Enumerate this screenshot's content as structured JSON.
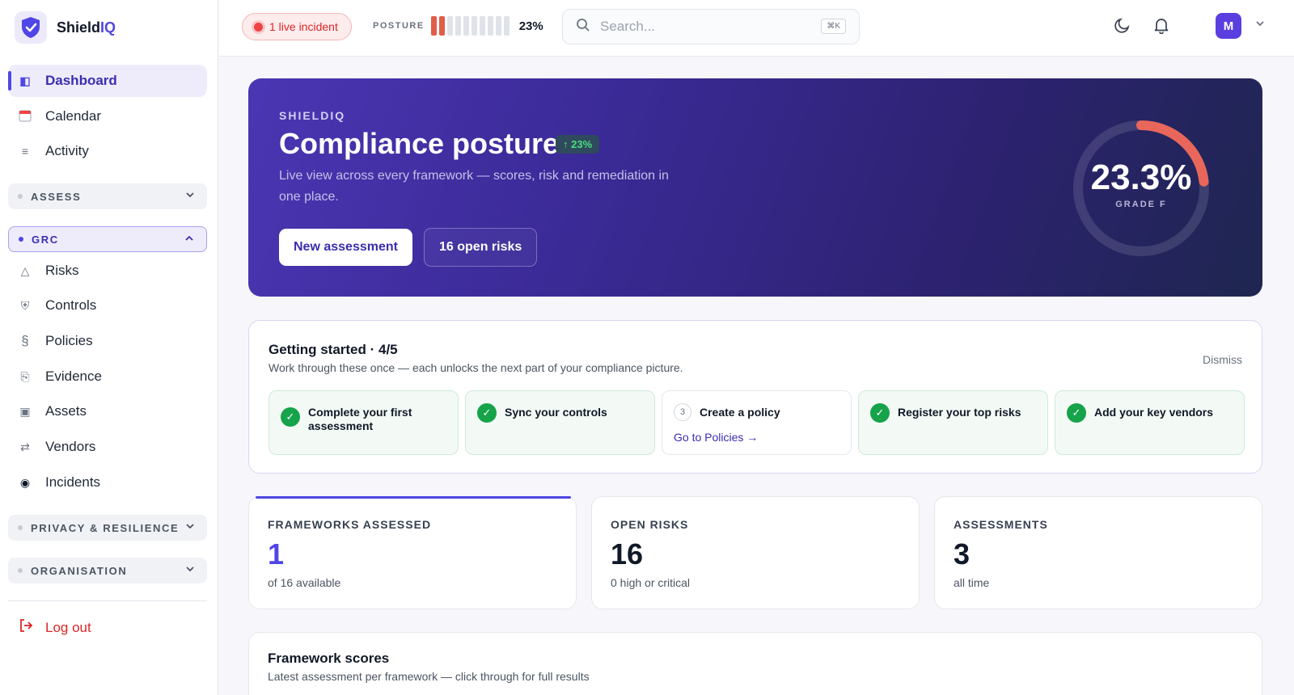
{
  "brand": {
    "name_main": "Shield",
    "name_accent": "IQ"
  },
  "sidebar": {
    "top_items": [
      {
        "label": "Dashboard",
        "icon": "dashboard-icon",
        "active": true
      },
      {
        "label": "Calendar",
        "icon": "calendar-icon"
      },
      {
        "label": "Activity",
        "icon": "activity-icon"
      }
    ],
    "sections": [
      {
        "label": "ASSESS",
        "expanded": false
      },
      {
        "label": "GRC",
        "expanded": true
      },
      {
        "label": "PRIVACY & RESILIENCE",
        "expanded": false
      },
      {
        "label": "ORGANISATION",
        "expanded": false
      }
    ],
    "grc_items": [
      {
        "label": "Risks",
        "icon": "warning-icon"
      },
      {
        "label": "Controls",
        "icon": "shield-icon"
      },
      {
        "label": "Policies",
        "icon": "section-icon"
      },
      {
        "label": "Evidence",
        "icon": "document-icon"
      },
      {
        "label": "Assets",
        "icon": "asset-icon"
      },
      {
        "label": "Vendors",
        "icon": "transfer-icon"
      },
      {
        "label": "Incidents",
        "icon": "incident-icon"
      }
    ],
    "logout_label": "Log out"
  },
  "topbar": {
    "incident_label": "1 live incident",
    "posture_label": "POSTURE",
    "posture_value": "23%",
    "posture_fraction": 0.23,
    "search_placeholder": "Search...",
    "search_shortcut": "⌘K",
    "avatar_initial": "M"
  },
  "hero": {
    "eyebrow": "SHIELDIQ",
    "title": "Compliance posture",
    "badge": "↑ 23%",
    "subtitle": "Live view across every framework — scores, risk and remediation in one place.",
    "primary_button": "New assessment",
    "secondary_button": "16 open risks",
    "gauge_value": "23.3%",
    "gauge_fraction": 0.233,
    "gauge_grade": "GRADE F"
  },
  "getting_started": {
    "title": "Getting started · 4/5",
    "subtitle": "Work through these once — each unlocks the next part of your compliance picture.",
    "dismiss_label": "Dismiss",
    "steps": [
      {
        "label": "Complete your first assessment",
        "done": true
      },
      {
        "label": "Sync your controls",
        "done": true
      },
      {
        "label": "Create a policy",
        "done": false,
        "number": "3",
        "link": "Go to Policies →"
      },
      {
        "label": "Register your top risks",
        "done": true
      },
      {
        "label": "Add your key vendors",
        "done": true
      }
    ]
  },
  "stats": [
    {
      "label": "FRAMEWORKS ASSESSED",
      "value": "1",
      "sub": "of 16 available"
    },
    {
      "label": "OPEN RISKS",
      "value": "16",
      "sub": "0 high or critical"
    },
    {
      "label": "ASSESSMENTS",
      "value": "3",
      "sub": "all time"
    }
  ],
  "framework_scores": {
    "title": "Framework scores",
    "subtitle": "Latest assessment per framework — click through for full results"
  },
  "colors": {
    "accent": "#4f46e5",
    "danger": "#dc2626",
    "success": "#16a34a",
    "gauge_arc": "#e8675a"
  }
}
